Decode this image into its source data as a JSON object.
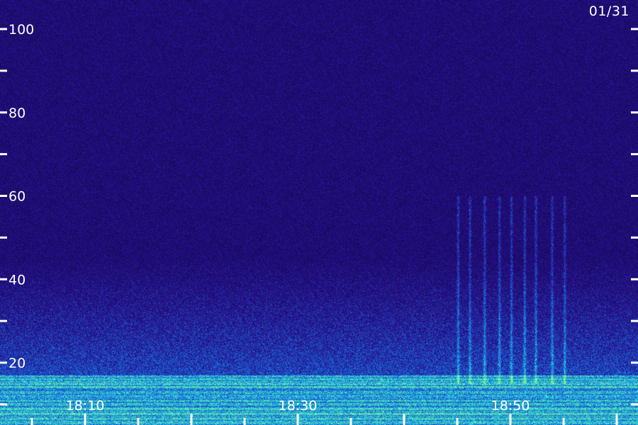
{
  "date_label": "01/31",
  "chart_data": {
    "type": "heatmap",
    "title": "",
    "xlabel": "",
    "ylabel": "",
    "x_tick_labels": [
      "18:10",
      "18:30",
      "18:50"
    ],
    "x_range": [
      "18:02",
      "19:02"
    ],
    "ylim": [
      -3,
      100
    ],
    "y_tick_labels": [
      20,
      40,
      60,
      80,
      100
    ],
    "y_minor_ticks": [
      10,
      30,
      50,
      70,
      90
    ],
    "x_minor_tick_interval_minutes": 5,
    "colors": {
      "background": "#2a1276",
      "low": "#1a0a5c",
      "mid": "#1f3cc8",
      "high": "#3fe0d0",
      "peak": "#a8ff70",
      "ticks": "#ffffff"
    },
    "features": [
      {
        "name": "low-frequency band",
        "freq_range": [
          0,
          17
        ],
        "intensity": "high"
      },
      {
        "name": "broadband emission",
        "freq_range": [
          17,
          45
        ],
        "intensity": "medium"
      },
      {
        "name": "vertical bursts",
        "time_range": [
          "18:45",
          "18:55"
        ],
        "freq_range": [
          15,
          60
        ],
        "intensity": "medium"
      }
    ]
  }
}
